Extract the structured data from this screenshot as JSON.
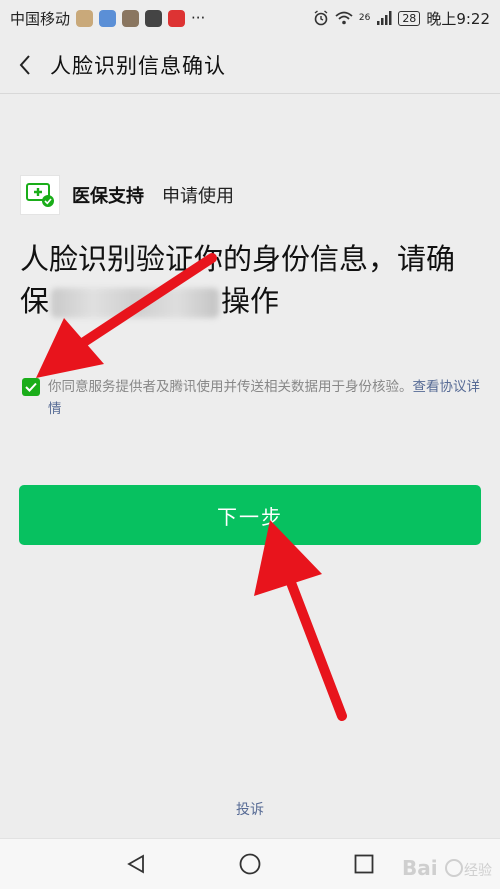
{
  "status_bar": {
    "carrier": "中国移动",
    "more": "···",
    "network": "26",
    "battery": "28",
    "time": "晚上9:22"
  },
  "nav": {
    "back_icon": "chevron-left-icon",
    "title": "人脸识别信息确认"
  },
  "app": {
    "name": "医保支持",
    "request": "申请使用",
    "logo_color": "#1aad19"
  },
  "heading": {
    "line_start": "人脸识别验证你的身份信息，请确保",
    "line_end": "操作"
  },
  "agreement": {
    "checked": true,
    "text": "你同意服务提供者及腾讯使用并传送相关数据用于身份核验。",
    "link": "查看协议详情"
  },
  "primary_button": {
    "label": "下一步",
    "color": "#07c160"
  },
  "footer": {
    "complain": "投诉"
  },
  "colors": {
    "background": "#ededed",
    "link": "#576b95",
    "arrow": "#e8141c"
  }
}
